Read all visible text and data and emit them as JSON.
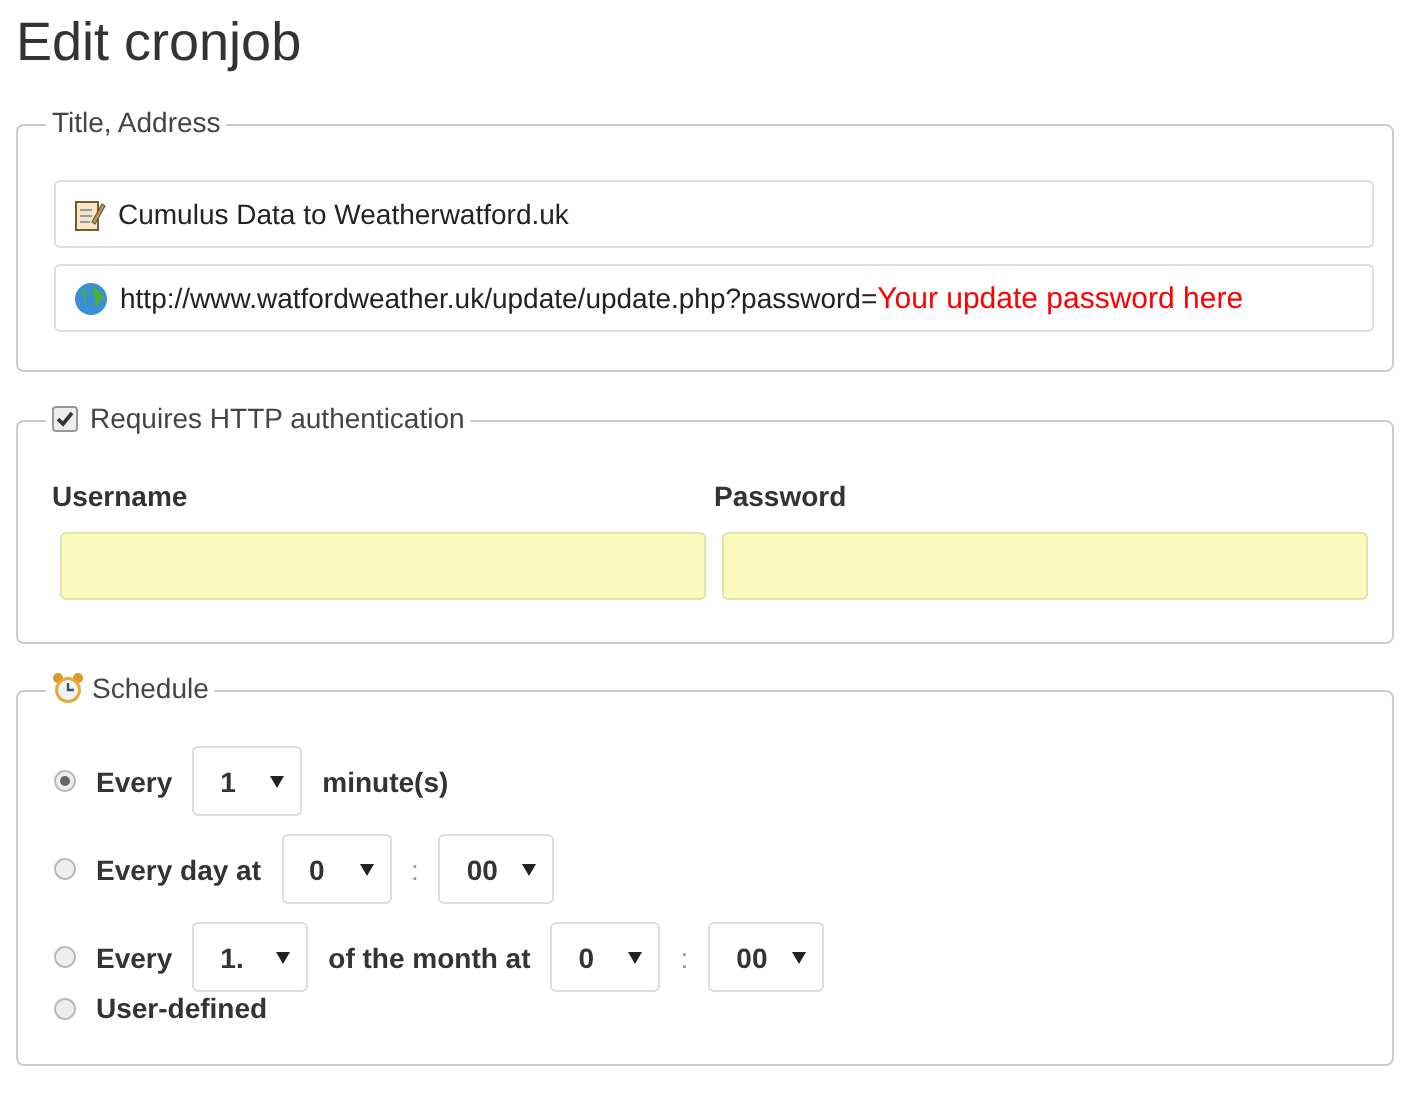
{
  "page_title": "Edit cronjob",
  "title_address": {
    "legend": "Title, Address",
    "title_value": "Cumulus Data to Weatherwatford.uk",
    "url_value": "http://www.watfordweather.uk/update/update.php?password=",
    "url_highlight": "Your update password here"
  },
  "auth": {
    "legend": "Requires HTTP authentication",
    "enabled": true,
    "username_label": "Username",
    "password_label": "Password"
  },
  "schedule": {
    "legend": "Schedule",
    "options": [
      {
        "selected": true,
        "parts": [
          {
            "kind": "text",
            "text": "Every"
          },
          {
            "kind": "select",
            "value": "1"
          },
          {
            "kind": "text",
            "text": "minute(s)"
          }
        ]
      },
      {
        "selected": false,
        "parts": [
          {
            "kind": "text",
            "text": "Every day at"
          },
          {
            "kind": "select",
            "value": "0"
          },
          {
            "kind": "sep",
            "text": ":"
          },
          {
            "kind": "select",
            "value": "00"
          }
        ]
      },
      {
        "selected": false,
        "parts": [
          {
            "kind": "text",
            "text": "Every"
          },
          {
            "kind": "select",
            "value": "1."
          },
          {
            "kind": "text",
            "text": "of the month at"
          },
          {
            "kind": "select",
            "value": "0"
          },
          {
            "kind": "sep",
            "text": ":"
          },
          {
            "kind": "select",
            "value": "00"
          }
        ]
      },
      {
        "selected": false,
        "parts": [
          {
            "kind": "text",
            "text": "User-defined"
          }
        ]
      }
    ]
  }
}
